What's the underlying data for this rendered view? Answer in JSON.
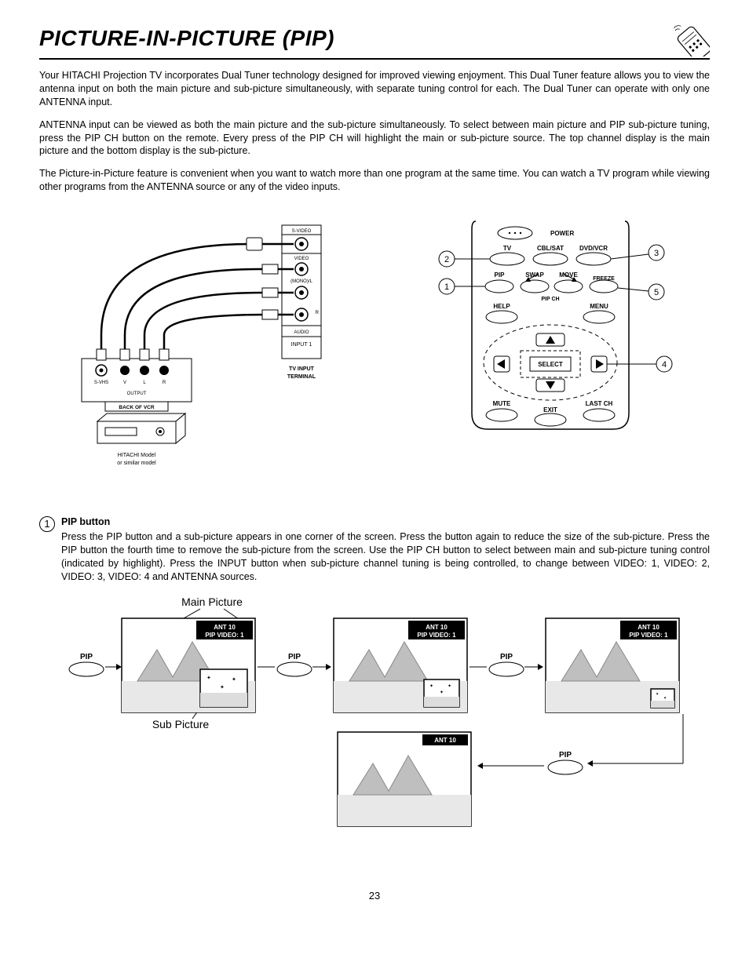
{
  "header": {
    "title": "PICTURE-IN-PICTURE (PIP)"
  },
  "intro": {
    "p1": "Your HITACHI Projection TV incorporates Dual Tuner technology designed for improved viewing enjoyment. This Dual Tuner feature allows you to view the antenna input on both the main picture and sub-picture simultaneously, with separate tuning control for each.  The Dual Tuner can operate with only one ANTENNA input.",
    "p2": "ANTENNA input can be viewed as both the main picture and the sub-picture simultaneously.  To select between main picture and PIP sub-picture tuning, press the PIP CH button on the remote.  Every press of the PIP CH will highlight the main or sub-picture source. The top channel display is the main picture and the bottom display is the sub-picture.",
    "p3": "The Picture-in-Picture feature is convenient when you want to watch more than one program at the same time.  You can watch a TV program while viewing other programs from the ANTENNA source or any of the video inputs."
  },
  "vcr": {
    "s_video": "S-VIDEO",
    "video": "VIDEO",
    "mono": "(MONO)/L",
    "r": "R",
    "audio": "AUDIO",
    "input1": "INPUT 1",
    "terminal_line1": "TV INPUT",
    "terminal_line2": "TERMINAL",
    "svhs": "S-VHS",
    "v": "V",
    "l": "L",
    "r2": "R",
    "output": "OUTPUT",
    "back": "BACK OF VCR",
    "model1": "HITACHI Model",
    "model2": "or similar model"
  },
  "remote": {
    "power": "POWER",
    "tv": "TV",
    "cblsat": "CBL/SAT",
    "dvdvcr": "DVD/VCR",
    "pip": "PIP",
    "swap": "SWAP",
    "move": "MOVE",
    "freeze": "FREEZE",
    "pipch": "PIP CH",
    "help": "HELP",
    "menu": "MENU",
    "select": "SELECT",
    "mute": "MUTE",
    "exit": "EXIT",
    "lastch": "LAST CH",
    "callouts": {
      "n1": "1",
      "n2": "2",
      "n3": "3",
      "n4": "4",
      "n5": "5"
    }
  },
  "section1": {
    "num": "1",
    "title": "PIP button",
    "desc": "Press the PIP button and a sub-picture appears in one corner of the screen.  Press the button again to reduce the size of the sub-picture. Press the PIP button the fourth time to remove the sub-picture from the screen.  Use the PIP CH button to select between main and sub-picture tuning control (indicated by highlight).  Press the INPUT button when sub-picture channel tuning is being controlled, to change between VIDEO: 1, VIDEO: 2, VIDEO: 3, VIDEO: 4  and ANTENNA sources."
  },
  "pip_seq": {
    "main_picture": "Main Picture",
    "sub_picture": "Sub Picture",
    "ant_full": "ANT   10",
    "pip_video": "PIP VIDEO: 1",
    "pip_label": "PIP"
  },
  "page_number": "23"
}
